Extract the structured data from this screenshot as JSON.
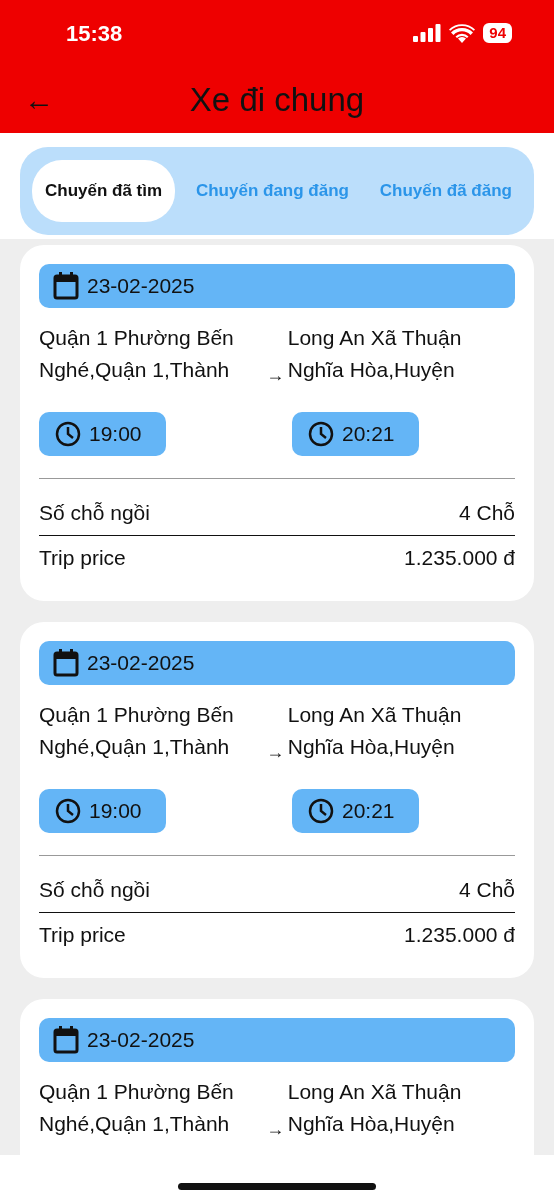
{
  "status_bar": {
    "time": "15:38",
    "battery": "94"
  },
  "app_bar": {
    "back": "←",
    "title": "Xe đi chung"
  },
  "tabs": [
    {
      "label": "Chuyến đã tìm",
      "selected": true
    },
    {
      "label": "Chuyến đang đăng",
      "selected": false
    },
    {
      "label": "Chuyến đã đăng",
      "selected": false
    }
  ],
  "trips": [
    {
      "date": "23-02-2025",
      "from": "Quận 1 Phường Bến Nghé,Quận 1,Thành",
      "to": "Long An Xã Thuận Nghĩa Hòa,Huyện",
      "arrow": "→",
      "depart": "19:00",
      "arrive": "20:21",
      "seats_label": "Số chỗ ngồi",
      "seats": "4 Chỗ",
      "price_label": "Trip price",
      "price": "1.235.000 đ"
    },
    {
      "date": "23-02-2025",
      "from": "Quận 1 Phường Bến Nghé,Quận 1,Thành",
      "to": "Long An Xã Thuận Nghĩa Hòa,Huyện",
      "arrow": "→",
      "depart": "19:00",
      "arrive": "20:21",
      "seats_label": "Số chỗ ngồi",
      "seats": "4 Chỗ",
      "price_label": "Trip price",
      "price": "1.235.000 đ"
    },
    {
      "date": "23-02-2025",
      "from": "Quận 1 Phường Bến Nghé,Quận 1,Thành",
      "to": "Long An Xã Thuận Nghĩa Hòa,Huyện",
      "arrow": "→"
    }
  ]
}
